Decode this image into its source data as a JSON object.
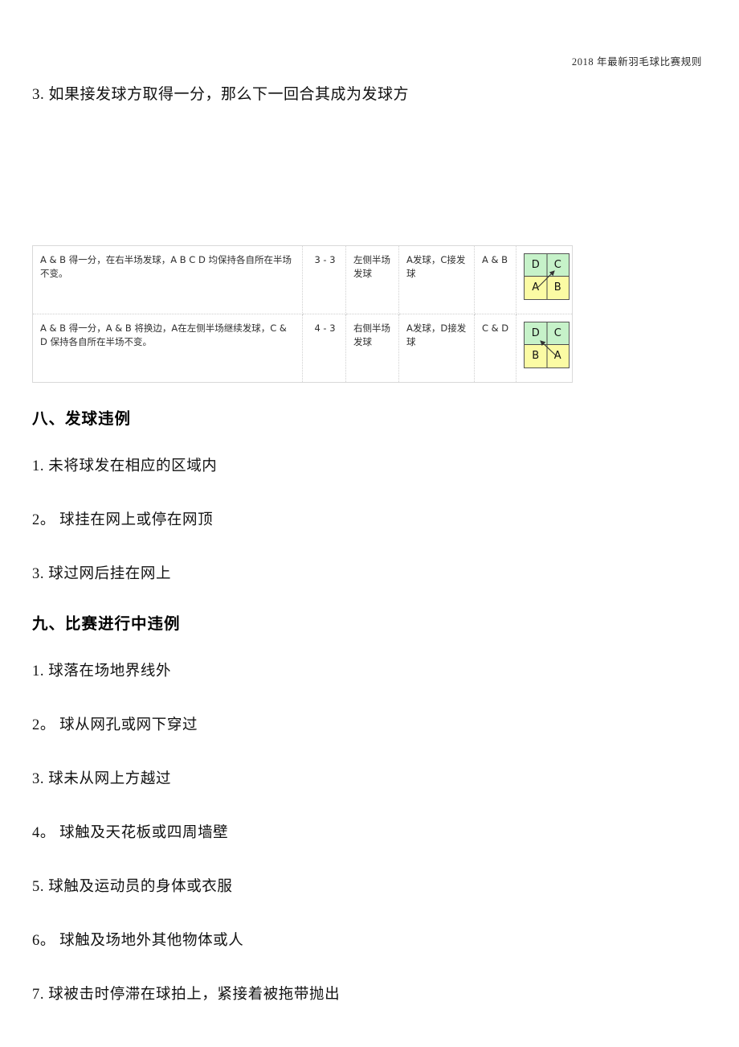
{
  "header": {
    "running_title": "2018 年最新羽毛球比赛规则"
  },
  "intro": {
    "item3": "3.  如果接发球方取得一分，那么下一回合其成为发球方"
  },
  "table": {
    "rows": [
      {
        "description": "A & B 得一分，在右半场发球，A B C D 均保持各自所在半场不变。",
        "score": "3 - 3",
        "serve_side": "左侧半场发球",
        "serve_receive": "A发球，C接发球",
        "team": "A & B",
        "diagram": {
          "top_left": "D",
          "top_right": "C",
          "bottom_left": "A",
          "bottom_right": "B",
          "arrow": "up-right",
          "top_color": "#c6f2c9",
          "bottom_color": "#fbfba4"
        }
      },
      {
        "description": "A & B 得一分，A & B 将换边，A在左侧半场继续发球，C & D 保持各自所在半场不变。",
        "score": "4 - 3",
        "serve_side": "右侧半场发球",
        "serve_receive": "A发球，D接发球",
        "team": "C & D",
        "diagram": {
          "top_left": "D",
          "top_right": "C",
          "bottom_left": "B",
          "bottom_right": "A",
          "arrow": "up-left",
          "top_color": "#c6f2c9",
          "bottom_color": "#fbfba4"
        }
      }
    ]
  },
  "section8": {
    "heading": "八、发球违例",
    "items": [
      "1.  未将球发在相应的区域内",
      "2。  球挂在网上或停在网顶",
      "3.  球过网后挂在网上"
    ]
  },
  "section9": {
    "heading": "九、比赛进行中违例",
    "items": [
      "1.  球落在场地界线外",
      "2。  球从网孔或网下穿过",
      "3.  球未从网上方越过",
      "4。  球触及天花板或四周墙壁",
      "5.  球触及运动员的身体或衣服",
      "6。  球触及场地外其他物体或人",
      "7.  球被击时停滞在球拍上，紧接着被拖带抛出"
    ]
  }
}
